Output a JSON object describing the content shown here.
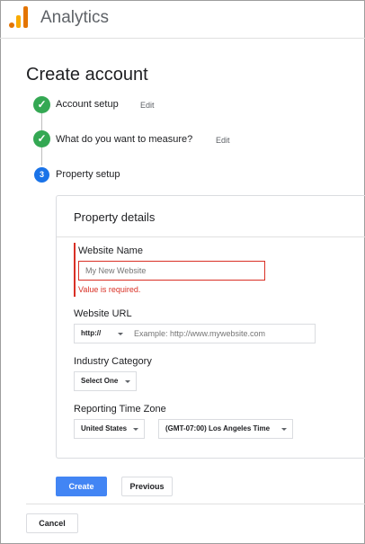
{
  "app": {
    "title": "Analytics"
  },
  "page": {
    "title": "Create account"
  },
  "steps": [
    {
      "label": "Account setup",
      "status": "done",
      "icon": "check-icon",
      "edit": "Edit"
    },
    {
      "label": "What do you want to measure?",
      "status": "done",
      "icon": "check-icon",
      "edit": "Edit"
    },
    {
      "label": "Property setup",
      "status": "active",
      "number": "3"
    }
  ],
  "property_details": {
    "title": "Property details",
    "website_name": {
      "label": "Website Name",
      "placeholder": "My New Website",
      "value": "",
      "error": "Value is required."
    },
    "website_url": {
      "label": "Website URL",
      "protocol": "http://",
      "placeholder": "Example: http://www.mywebsite.com",
      "value": ""
    },
    "industry_category": {
      "label": "Industry Category",
      "selected": "Select One"
    },
    "reporting_time_zone": {
      "label": "Reporting Time Zone",
      "country": "United States",
      "zone": "(GMT-07:00) Los Angeles Time"
    }
  },
  "actions": {
    "create": "Create",
    "previous": "Previous",
    "cancel": "Cancel"
  },
  "colors": {
    "accent": "#4285f4",
    "success": "#34a853",
    "error": "#d93025",
    "logo_orange": "#e37400",
    "logo_yellow": "#f9ab00"
  }
}
